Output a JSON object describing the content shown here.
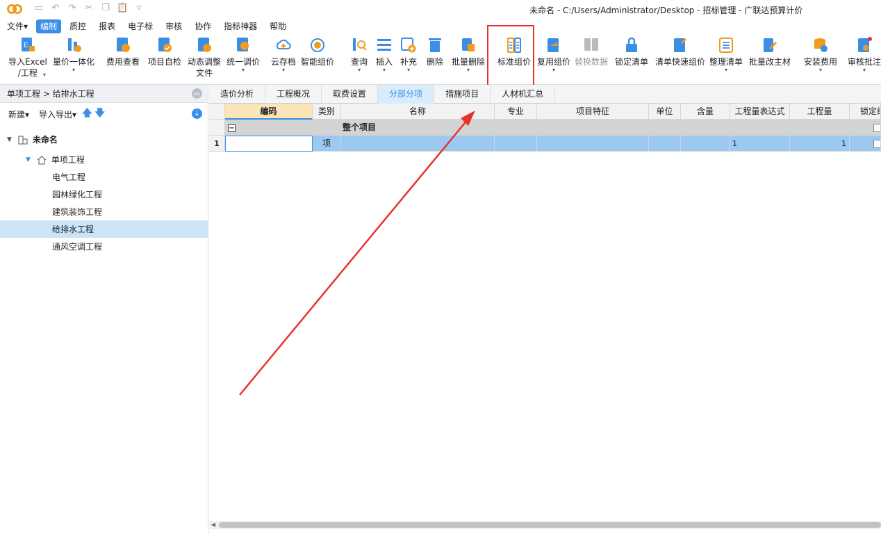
{
  "window": {
    "title": "未命名 - C:/Users/Administrator/Desktop - 招标管理 - 广联达预算计价"
  },
  "menu": [
    "文件▾",
    "编制",
    "质控",
    "报表",
    "电子标",
    "审核",
    "协作",
    "指标神器",
    "帮助"
  ],
  "ribbon": {
    "import_excel": "导入Excel",
    "import_excel_2": "/工程",
    "price_integration": "量价一体化",
    "fee_view": "费用查看",
    "self_check": "项目自检",
    "dynamic_adjust": "动态调整",
    "dynamic_adjust_2": "文件",
    "unified_price": "统一调价",
    "cloud_archive": "云存档",
    "smart_pricing": "智能组价",
    "query": "查询",
    "insert": "插入",
    "supplement": "补充",
    "delete": "删除",
    "batch_delete": "批量删除",
    "standard_pricing": "标准组价",
    "reuse_pricing": "复用组价",
    "replace_data": "替换数据",
    "lock_list": "锁定清单",
    "quick_pricing": "清单快速组价",
    "organize_list": "整理清单",
    "batch_main_material": "批量改主材",
    "install_fee": "安装费用",
    "review_note": "审核批注",
    "caret": "▾"
  },
  "left": {
    "breadcrumb": "单项工程 > 给排水工程",
    "new": "新建▾",
    "import_export": "导入导出▾",
    "up": "🡅",
    "down": "🡇",
    "tree": {
      "root": "未命名",
      "single": "单项工程",
      "items": [
        "电气工程",
        "园林绿化工程",
        "建筑装饰工程",
        "给排水工程",
        "通风空调工程"
      ]
    }
  },
  "tabs": [
    "造价分析",
    "工程概况",
    "取费设置",
    "分部分项",
    "措施项目",
    "人材机汇总"
  ],
  "grid": {
    "headers": {
      "code": "编码",
      "type": "类别",
      "name": "名称",
      "specialty": "专业",
      "feature": "项目特征",
      "unit": "单位",
      "content": "含量",
      "qty_expr": "工程量表达式",
      "qty": "工程量",
      "locked": "锁定综合"
    },
    "summary": {
      "toggle": "−",
      "name": "整个项目"
    },
    "rows": [
      {
        "num": "1",
        "type": "项",
        "qty_expr": "1",
        "qty": "1"
      }
    ]
  },
  "colors": {
    "accent": "#3b8ee6",
    "highlight": "#e8312b",
    "selected_row": "#9dc9f0"
  }
}
